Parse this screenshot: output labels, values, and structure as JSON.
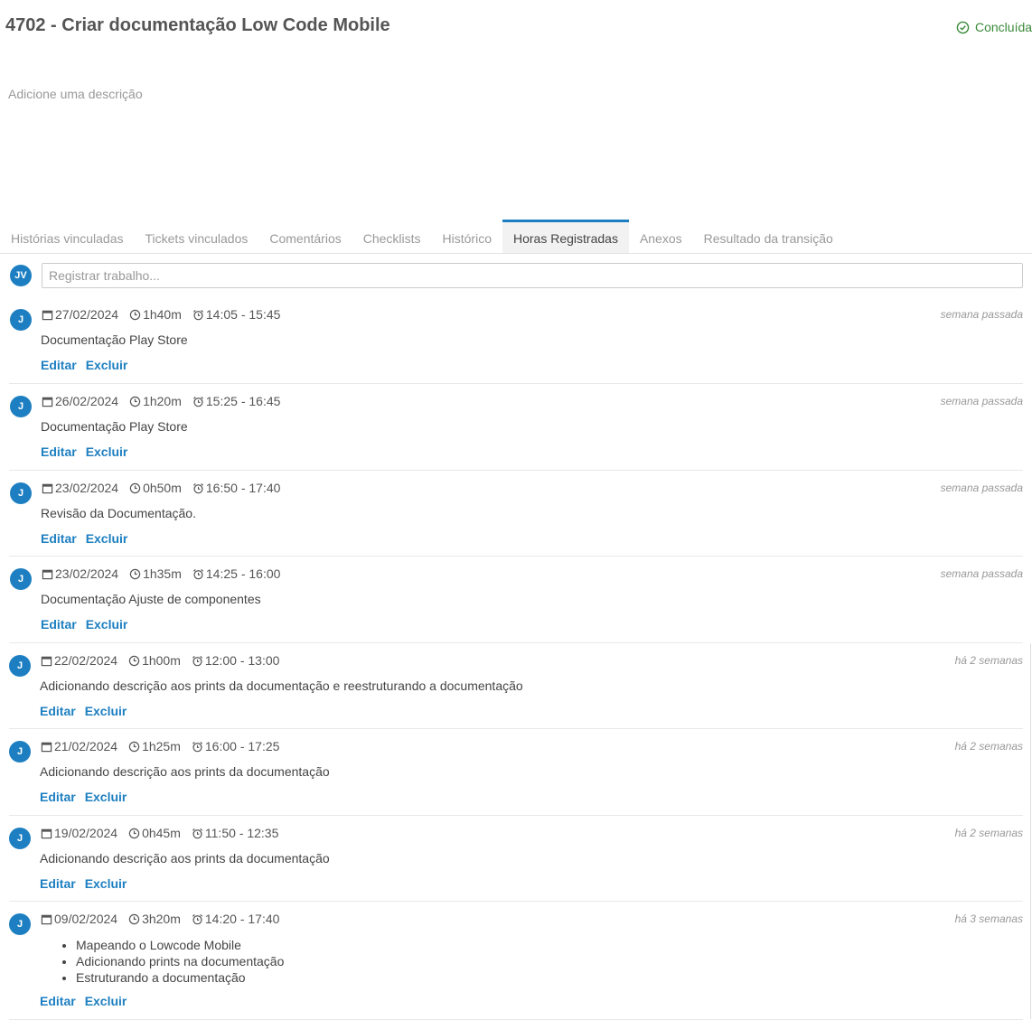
{
  "task": {
    "title": "4702 - Criar documentação Low Code Mobile",
    "status": "Concluída",
    "status_color": "#3a8a3a",
    "description_placeholder": "Adicione uma descrição"
  },
  "tabs": [
    {
      "label": "Histórias vinculadas"
    },
    {
      "label": "Tickets vinculados"
    },
    {
      "label": "Comentários"
    },
    {
      "label": "Checklists"
    },
    {
      "label": "Histórico"
    },
    {
      "label": "Horas Registradas",
      "active": true
    },
    {
      "label": "Anexos"
    },
    {
      "label": "Resultado da transição"
    }
  ],
  "composer": {
    "avatar": "JV",
    "placeholder": "Registrar trabalho..."
  },
  "entries": [
    {
      "avatar": "J",
      "date": "27/02/2024",
      "duration": "1h40m",
      "range": "14:05 - 15:45",
      "when": "semana passada",
      "description": "Documentação Play Store",
      "edit": "Editar",
      "delete": "Excluir"
    },
    {
      "avatar": "J",
      "date": "26/02/2024",
      "duration": "1h20m",
      "range": "15:25 - 16:45",
      "when": "semana passada",
      "description": "Documentação Play Store",
      "edit": "Editar",
      "delete": "Excluir"
    },
    {
      "avatar": "J",
      "date": "23/02/2024",
      "duration": "0h50m",
      "range": "16:50 - 17:40",
      "when": "semana passada",
      "description": "Revisão da Documentação.",
      "edit": "Editar",
      "delete": "Excluir"
    },
    {
      "avatar": "J",
      "date": "23/02/2024",
      "duration": "1h35m",
      "range": "14:25 - 16:00",
      "when": "semana passada",
      "description": "Documentação Ajuste de componentes",
      "edit": "Editar",
      "delete": "Excluir"
    },
    {
      "avatar": "J",
      "date": "22/02/2024",
      "duration": "1h00m",
      "range": "12:00 - 13:00",
      "when": "há 2 semanas",
      "description": "Adicionando descrição aos prints da documentação e reestruturando a documentação",
      "edit": "Editar",
      "delete": "Excluir"
    },
    {
      "avatar": "J",
      "date": "21/02/2024",
      "duration": "1h25m",
      "range": "16:00 - 17:25",
      "when": "há 2 semanas",
      "description": "Adicionando descrição aos prints da documentação",
      "edit": "Editar",
      "delete": "Excluir"
    },
    {
      "avatar": "J",
      "date": "19/02/2024",
      "duration": "0h45m",
      "range": "11:50 - 12:35",
      "when": "há 2 semanas",
      "description": "Adicionando descrição aos prints da documentação",
      "edit": "Editar",
      "delete": "Excluir"
    },
    {
      "avatar": "J",
      "date": "09/02/2024",
      "duration": "3h20m",
      "range": "14:20 - 17:40",
      "when": "há 3 semanas",
      "bullets": [
        "Mapeando o Lowcode Mobile",
        "Adicionando prints na documentação",
        "Estruturando a documentação"
      ],
      "edit": "Editar",
      "delete": "Excluir"
    }
  ]
}
